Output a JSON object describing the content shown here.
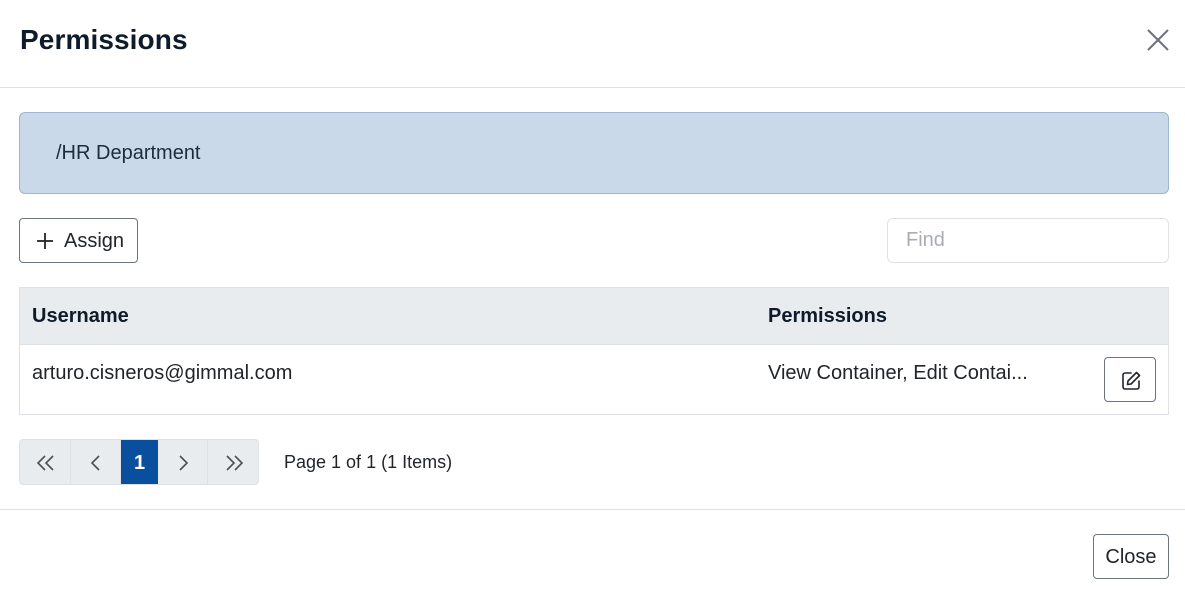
{
  "dialog": {
    "title": "Permissions",
    "close_icon": "close-x-icon"
  },
  "banner": {
    "path": "/HR Department"
  },
  "toolbar": {
    "assign_icon": "plus-icon",
    "assign_label": "Assign",
    "find_placeholder": "Find",
    "find_value": ""
  },
  "grid": {
    "columns": [
      "Username",
      "Permissions"
    ],
    "rows": [
      {
        "username": "arturo.cisneros@gimmal.com",
        "permissions": "View Container, Edit Container",
        "permissions_displayed": "View Container, Edit Contai...",
        "action_icon": "edit-icon"
      }
    ]
  },
  "pagination": {
    "first_icon": "double-chevron-left-icon",
    "prev_icon": "chevron-left-icon",
    "current_page": "1",
    "next_icon": "chevron-right-icon",
    "last_icon": "double-chevron-right-icon",
    "summary": "Page 1 of 1 (1 Items)"
  },
  "footer": {
    "close_label": "Close"
  },
  "colors": {
    "banner_bg": "#c9d9ea",
    "active_page": "#0a4f9e",
    "header_bg": "#e9ecef"
  }
}
